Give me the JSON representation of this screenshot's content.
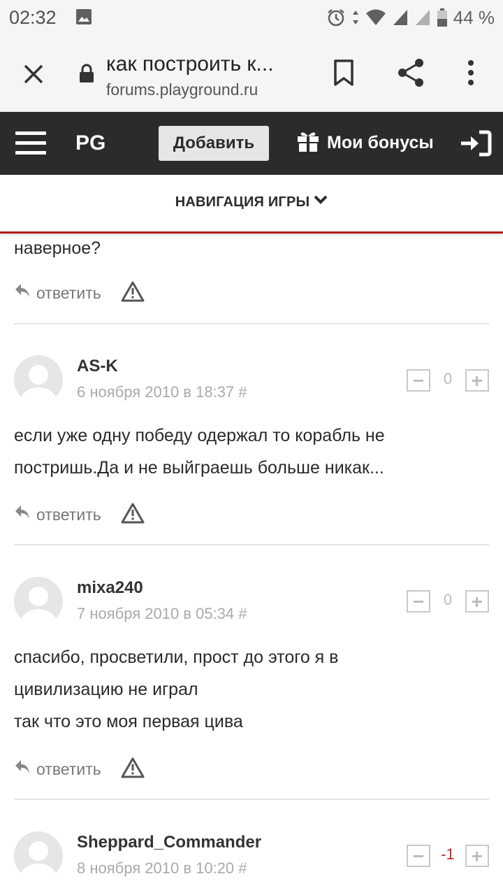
{
  "status_bar": {
    "time": "02:32",
    "battery": "44 %"
  },
  "browser": {
    "page_title": "как построить к...",
    "domain": "forums.playground.ru"
  },
  "site_header": {
    "logo": "PG",
    "add_label": "Добавить",
    "bonus_label": "Мои бонусы"
  },
  "game_nav": {
    "label": "НАВИГАЦИЯ ИГРЫ"
  },
  "prev_comment": {
    "text_tail": "наверное?",
    "reply_label": "ответить"
  },
  "comments": [
    {
      "author": "AS-K",
      "date": "6 ноября 2010 в 18:37 #",
      "score": "0",
      "lines": [
        "если уже одну победу одержал то корабль не",
        "постришь.Да и не выйграешь больше никак..."
      ],
      "reply_label": "ответить"
    },
    {
      "author": "mixa240",
      "date": "7 ноября 2010 в 05:34 #",
      "score": "0",
      "lines": [
        "спасибо, просветили, прост до этого я в",
        "цивилизацию не играл",
        "так что это моя первая цива"
      ],
      "reply_label": "ответить"
    },
    {
      "author": "Sheppard_Commander",
      "date": "8 ноября 2010 в 10:20 #",
      "score": "-1"
    }
  ],
  "colors": {
    "header_bg": "#2b2b2b",
    "accent_red": "#b71c1c",
    "negative_score": "#c62828"
  },
  "icons": [
    "gallery-icon",
    "alarm-icon",
    "wifi-icon",
    "signal-icon",
    "battery-icon",
    "close-icon",
    "lock-icon",
    "bookmark-icon",
    "share-icon",
    "more-vert-icon",
    "menu-icon",
    "gift-icon",
    "login-icon",
    "chevron-down-icon",
    "reply-icon",
    "report-icon",
    "avatar-icon"
  ]
}
